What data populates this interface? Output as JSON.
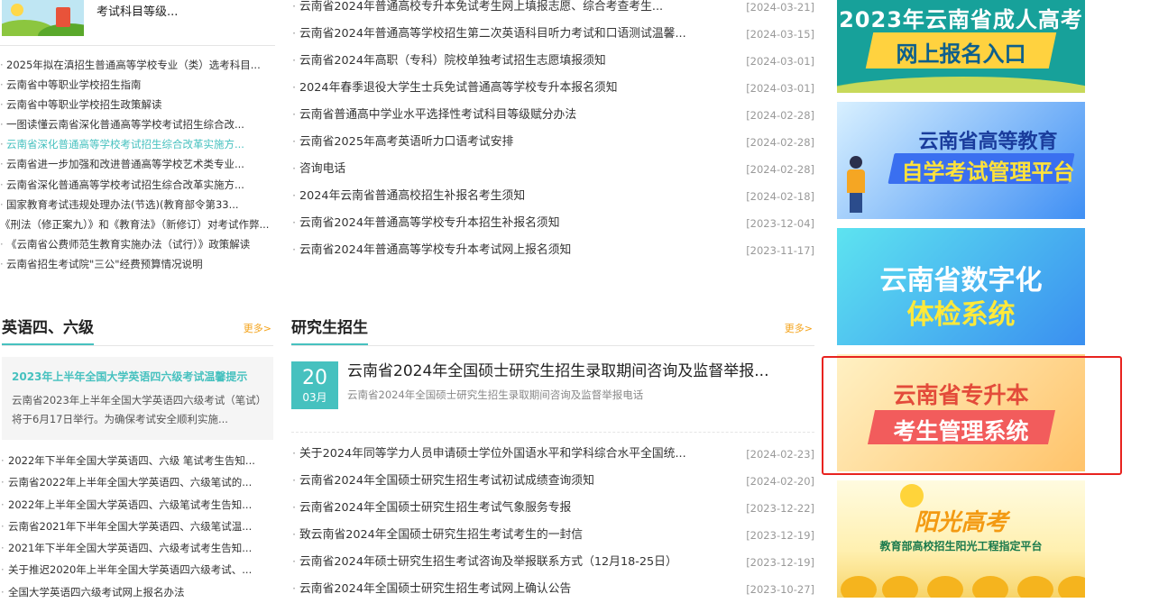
{
  "top_feature": {
    "title": "考试科目等级..."
  },
  "left_list": [
    "2025年拟在滇招生普通高等学校专业（类）选考科目...",
    "云南省中等职业学校招生指南",
    "云南省中等职业学校招生政策解读",
    "一图读懂云南省深化普通高等学校考试招生综合改...",
    "云南省深化普通高等学校考试招生综合改革实施方...",
    "云南省进一步加强和改进普通高等学校艺术类专业...",
    "云南省深化普通高等学校考试招生综合改革实施方...",
    "国家教育考试违规处理办法(节选)(教育部令第33...",
    "《刑法（修正案九）》和《教育法》（新修订）对考试作弊...",
    "《云南省公费师范生教育实施办法（试行）》政策解读",
    "云南省招生考试院\"三公\"经费预算情况说明"
  ],
  "middle_top_list": [
    {
      "title": "云南省2024年普通高校专升本免试考生网上填报志愿、综合考查考生...",
      "date": "[2024-03-21]"
    },
    {
      "title": "云南省2024年普通高等学校招生第二次英语科目听力考试和口语测试温馨...",
      "date": "[2024-03-15]"
    },
    {
      "title": "云南省2024年高职（专科）院校单独考试招生志愿填报须知",
      "date": "[2024-03-01]"
    },
    {
      "title": "2024年春季退役大学生士兵免试普通高等学校专升本报名须知",
      "date": "[2024-03-01]"
    },
    {
      "title": "云南省普通高中学业水平选择性考试科目等级赋分办法",
      "date": "[2024-02-28]"
    },
    {
      "title": "云南省2025年高考英语听力口语考试安排",
      "date": "[2024-02-28]"
    },
    {
      "title": "咨询电话",
      "date": "[2024-02-28]"
    },
    {
      "title": "2024年云南省普通高校招生补报名考生须知",
      "date": "[2024-02-18]"
    },
    {
      "title": "云南省2024年普通高等学校专升本招生补报名须知",
      "date": "[2023-12-04]"
    },
    {
      "title": "云南省2024年普通高等学校专升本考试网上报名须知",
      "date": "[2023-11-17]"
    }
  ],
  "english": {
    "title": "英语四、六级",
    "more": "更多>",
    "box_title": "2023年上半年全国大学英语四六级考试温馨提示",
    "box_body": "云南省2023年上半年全国大学英语四六级考试（笔试）将于6月17日举行。为确保考试安全顺利实施...",
    "list": [
      "2022年下半年全国大学英语四、六级 笔试考生告知...",
      "云南省2022年上半年全国大学英语四、六级笔试的...",
      "2022年上半年全国大学英语四、六级笔试考生告知...",
      "云南省2021年下半年全国大学英语四、六级笔试温...",
      "2021年下半年全国大学英语四、六级考试考生告知...",
      "关于推迟2020年上半年全国大学英语四六级考试、...",
      "全国大学英语四六级考试网上报名办法"
    ]
  },
  "graduate": {
    "title": "研究生招生",
    "more": "更多>",
    "feature": {
      "day": "20",
      "month": "03月",
      "title": "云南省2024年全国硕士研究生招生录取期间咨询及监督举报...",
      "subtitle": "云南省2024年全国硕士研究生招生录取期间咨询及监督举报电话"
    },
    "list": [
      {
        "title": "关于2024年同等学力人员申请硕士学位外国语水平和学科综合水平全国统...",
        "date": "[2024-02-23]"
      },
      {
        "title": "云南省2024年全国硕士研究生招生考试初试成绩查询须知",
        "date": "[2024-02-20]"
      },
      {
        "title": "云南省2024年全国硕士研究生招生考试气象服务专报",
        "date": "[2023-12-22]"
      },
      {
        "title": "致云南省2024年全国硕士研究生招生考试考生的一封信",
        "date": "[2023-12-19]"
      },
      {
        "title": "云南省2024年硕士研究生招生考试咨询及举报联系方式（12月18-25日）",
        "date": "[2023-12-19]"
      },
      {
        "title": "云南省2024年全国硕士研究生招生考试网上确认公告",
        "date": "[2023-10-27]"
      }
    ]
  },
  "banners": {
    "b1": {
      "line1": "2023年云南省成人高考",
      "line2": "网上报名入口"
    },
    "b2": {
      "line1": "云南省高等教育",
      "line2": "自学考试管理平台"
    },
    "b3": {
      "line1": "云南省数字化",
      "line2": "体检系统"
    },
    "b4": {
      "line1": "云南省专升本",
      "line2": "考生管理系统"
    },
    "b5": {
      "line1": "阳光高考",
      "line2": "教育部高校招生阳光工程指定平台"
    }
  },
  "colors": {
    "accent": "#46c1bf",
    "more": "#f4a31a",
    "highlight": "#e8231f"
  }
}
